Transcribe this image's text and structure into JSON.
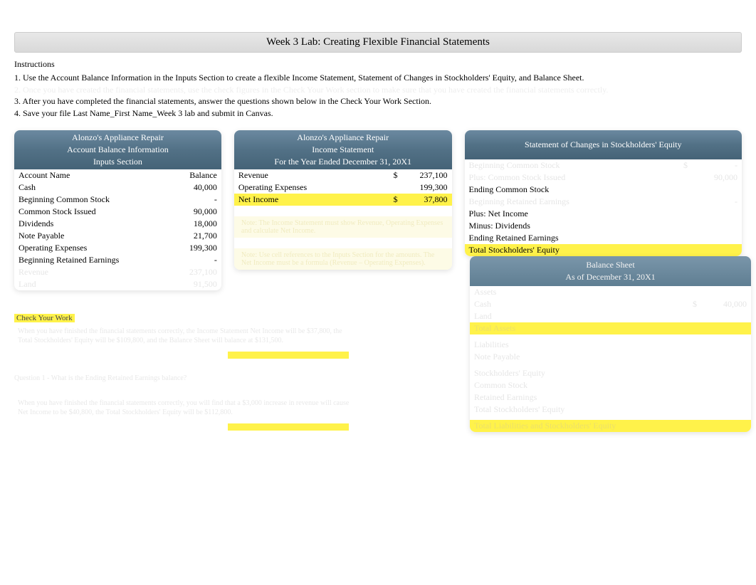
{
  "title": "Week 3 Lab: Creating Flexible Financial Statements",
  "instructions": {
    "heading": "Instructions",
    "items": {
      "i1": "1. Use the Account Balance Information in the Inputs Section to create a flexible Income Statement, Statement of Changes in Stockholders' Equity, and Balance Sheet.",
      "i2_faded": "2. Once you have created the financial statements, use the check figures in the Check Your Work section to make sure that you have created the financial statements correctly.",
      "i3": "3. After you have completed the financial statements, answer the questions shown below in the Check Your Work Section.",
      "i4": "4. Save your file Last Name_First Name_Week 3 lab and submit in Canvas."
    }
  },
  "inputs": {
    "header": {
      "l1": "Alonzo's Appliance Repair",
      "l2": "Account Balance Information",
      "l3": "Inputs Section"
    },
    "cols": {
      "name": "Account Name",
      "bal": "Balance"
    },
    "rows": [
      {
        "name": "Cash",
        "bal": "40,000"
      },
      {
        "name": "Beginning Common Stock",
        "bal": "-"
      },
      {
        "name": "Common Stock Issued",
        "bal": "90,000"
      },
      {
        "name": "Dividends",
        "bal": "18,000"
      },
      {
        "name": "Note Payable",
        "bal": "21,700"
      },
      {
        "name": "Operating Expenses",
        "bal": "199,300"
      },
      {
        "name": "Beginning Retained Earnings",
        "bal": "-"
      }
    ]
  },
  "income": {
    "header": {
      "l1": "Alonzo's Appliance Repair",
      "l2": "Income Statement",
      "l3": "For the Year Ended December 31, 20X1"
    },
    "rows": {
      "revenue": {
        "label": "Revenue",
        "cur": "$",
        "amt": "237,100"
      },
      "opexp": {
        "label": "Operating Expenses",
        "cur": "",
        "amt": "199,300"
      },
      "netincome": {
        "label": "Net Income",
        "cur": "$",
        "amt": "37,800"
      }
    }
  },
  "equity": {
    "header": "Statement of Changes in Stockholders' Equity",
    "rows": {
      "bcs_faded": "Beginning Common Stock",
      "pci_faded": "Plus: Common Stock Issued",
      "ecs": "Ending Common Stock",
      "bre_faded": "Beginning Retained Earnings",
      "pni": "Plus: Net Income",
      "md": "Minus: Dividends",
      "ere": "Ending Retained Earnings",
      "tse": "Total Stockholders' Equity"
    }
  },
  "balance": {
    "header": {
      "l1": "Balance Sheet",
      "l2": "As of December 31, 20X1"
    },
    "rows": {
      "assets": "Assets",
      "cash": "Cash",
      "land": "Land",
      "ta": "Total Assets",
      "liab": "Liabilities",
      "np": "Note Payable",
      "se": "Stockholders' Equity",
      "cs": "Common Stock",
      "re": "Retained Earnings",
      "tse": "Total Stockholders' Equity",
      "tlse": "Total Liabilities and Stockholders' Equity"
    }
  },
  "check": {
    "heading": "Check Your Work",
    "q1": "When you have finished the financial statements correctly, the Income Statement Net Income will be $37,800, the Total Stockholders' Equity will be $109,800, and the Balance Sheet will balance at $131,500.",
    "q2": "Question 1 - What is the Ending Retained Earnings balance?",
    "q3": "When you have finished the financial statements correctly, you will find that a $3,000 increase in revenue will cause Net Income to be $40,800, the Total Stockholders' Equity will be $112,800."
  }
}
